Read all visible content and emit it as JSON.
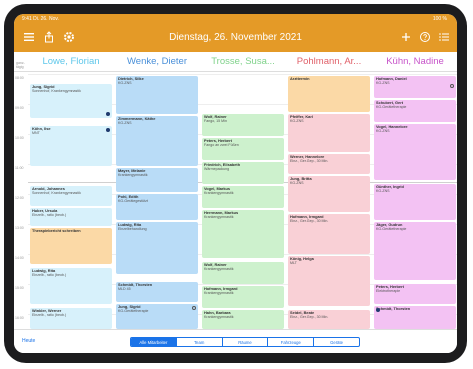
{
  "status": {
    "time": "9:41 Di. 26. Nov.",
    "right": "100 %"
  },
  "toolbar": {
    "title": "Dienstag, 26. November 2021"
  },
  "allday_label": "ganz-tägig",
  "columns": [
    {
      "name": "Lowe, Florian",
      "color": "#5ec7ea"
    },
    {
      "name": "Wenke, Dieter",
      "color": "#4a90d9"
    },
    {
      "name": "Trosse, Susa...",
      "color": "#7fd28a"
    },
    {
      "name": "Pohlmann, Ar...",
      "color": "#e0616a"
    },
    {
      "name": "Kühn, Nadine",
      "color": "#c653c9"
    }
  ],
  "hours": [
    "08:00",
    "09:00",
    "10:00",
    "11:00",
    "12:00",
    "13:00",
    "14:00",
    "15:00",
    "16:00"
  ],
  "appointments": [
    {
      "col": 0,
      "title": "Jung, Sigrid",
      "sub": "Sonnenhof, Krankengymnastik",
      "color": "#d7f1fb",
      "marker": "none"
    },
    {
      "col": 0,
      "title": "Köhn, Ilse",
      "sub": "MNT",
      "color": "#d7f1fb",
      "marker": "dot"
    },
    {
      "col": 0,
      "title": "Arnold, Johannes",
      "sub": "Sonnenhof, Krankengymnastik",
      "color": "#d7f1fb",
      "marker": "none"
    },
    {
      "col": 0,
      "title": "Huber, Ursula",
      "sub": "Einzelb., ratio (beob.)",
      "color": "#d7f1fb",
      "marker": "none"
    },
    {
      "col": 0,
      "title": "Therapiebericht schreiben",
      "sub": "",
      "color": "#fbd9a6",
      "marker": "none"
    },
    {
      "col": 0,
      "title": "Ludwig, Rita",
      "sub": "Einzelb., ratio (beob.)",
      "color": "#d7f1fb",
      "marker": "none"
    },
    {
      "col": 0,
      "title": "Winkler, Werner",
      "sub": "Einzelb., ratio (beob.)",
      "color": "#d7f1fb",
      "marker": "none"
    },
    {
      "col": 1,
      "title": "Dietrich, Silke",
      "sub": "KG-ZNS",
      "color": "#b9dcf7",
      "marker": "none"
    },
    {
      "col": 1,
      "title": "Zimmermann, Käthe",
      "sub": "KG-ZNS",
      "color": "#b9dcf7",
      "marker": "none"
    },
    {
      "col": 1,
      "title": "Mayer, Melanie",
      "sub": "Krankengymnastik",
      "color": "#b9dcf7",
      "marker": "none"
    },
    {
      "col": 1,
      "title": "Pohl, Edith",
      "sub": "KG-Gerätegestützt",
      "color": "#b9dcf7",
      "marker": "none"
    },
    {
      "col": 1,
      "title": "Ludwig, Rita",
      "sub": "Einzelbehandlung",
      "color": "#b9dcf7",
      "marker": "none"
    },
    {
      "col": 1,
      "title": "Schmidt, Thorsten",
      "sub": "MLD 45",
      "color": "#b9dcf7",
      "marker": "none"
    },
    {
      "col": 1,
      "title": "Jung, Sigrid",
      "sub": "KG-Gerätetherapie",
      "color": "#b9dcf7",
      "marker": "ring"
    },
    {
      "col": 2,
      "title": "Wolf, Rainer",
      "sub": "Fango, 15 Min",
      "color": "#cdf1cd",
      "marker": "none"
    },
    {
      "col": 2,
      "title": "Peters, Herbert",
      "sub": "Fango an zwei Füßen",
      "color": "#cdf1cd",
      "marker": "none"
    },
    {
      "col": 2,
      "title": "Friedrich, Elisabeth",
      "sub": "Wärmepackung",
      "color": "#cdf1cd",
      "marker": "none"
    },
    {
      "col": 2,
      "title": "Vogel, Markus",
      "sub": "Krankengymnastik",
      "color": "#cdf1cd",
      "marker": "none"
    },
    {
      "col": 2,
      "title": "Herrmann, Markus",
      "sub": "Krankengymnastik",
      "color": "#cdf1cd",
      "marker": "none"
    },
    {
      "col": 2,
      "title": "Wolf, Rainer",
      "sub": "Krankengymnastik",
      "color": "#cdf1cd",
      "marker": "none"
    },
    {
      "col": 2,
      "title": "Hofmann, Irmgard",
      "sub": "Krankengymnastik",
      "color": "#cdf1cd",
      "marker": "none"
    },
    {
      "col": 2,
      "title": "Hahn, Barbara",
      "sub": "Krankengymnastik",
      "color": "#cdf1cd",
      "marker": "none"
    },
    {
      "col": 3,
      "title": "Arzttermin",
      "sub": "",
      "color": "#fbd9a6",
      "marker": "none"
    },
    {
      "col": 3,
      "title": "Pfeiffer, Karl",
      "sub": "KG-ZNS",
      "color": "#f9d0d6",
      "marker": "none"
    },
    {
      "col": 3,
      "title": "Werner, Hannelore",
      "sub": "Einz., Ger.Gep., 30 Min.",
      "color": "#f9d0d6",
      "marker": "none"
    },
    {
      "col": 3,
      "title": "Jung, Britta",
      "sub": "KG-ZNS",
      "color": "#f9d0d6",
      "marker": "none"
    },
    {
      "col": 3,
      "title": "Hofmann, Irmgard",
      "sub": "Einz., Ger.Gep., 30 Min.",
      "color": "#f9d0d6",
      "marker": "none"
    },
    {
      "col": 3,
      "title": "König, Helga",
      "sub": "MLT",
      "color": "#f9d0d6",
      "marker": "none"
    },
    {
      "col": 3,
      "title": "Seidel, Beate",
      "sub": "Einz., Ger.Gep., 30 Min.",
      "color": "#f9d0d6",
      "marker": "none"
    },
    {
      "col": 4,
      "title": "Hofmann, Daniel",
      "sub": "KG-ZNS",
      "color": "#f3c2f3",
      "marker": "ring"
    },
    {
      "col": 4,
      "title": "Schubert, Gert",
      "sub": "KG-Gerätetherapie",
      "color": "#f3c2f3",
      "marker": "none"
    },
    {
      "col": 4,
      "title": "Vogel, Hannelore",
      "sub": "KG-ZNS",
      "color": "#f3c2f3",
      "marker": "none"
    },
    {
      "col": 4,
      "title": "Günther, Ingrid",
      "sub": "KG-ZNS",
      "color": "#f3c2f3",
      "marker": "none"
    },
    {
      "col": 4,
      "title": "Jäger, Gudrun",
      "sub": "KG-Gerätetherapie",
      "color": "#f3c2f3",
      "marker": "none"
    },
    {
      "col": 4,
      "title": "Peters, Herbert",
      "sub": "Elektrotherapie",
      "color": "#f3c2f3",
      "marker": "none"
    },
    {
      "col": 4,
      "title": "Schmidt, Thorsten",
      "sub": "",
      "color": "#f3c2f3",
      "marker": "dot"
    }
  ],
  "bottom": {
    "today": "Heute",
    "segments": [
      "Alle Mitarbeiter",
      "Team",
      "Räume",
      "Fahrzeuge",
      "Geräte"
    ],
    "active_segment": "Alle Mitarbeiter"
  },
  "icons": [
    "menu-icon",
    "share-icon",
    "settings-icon",
    "add-icon",
    "help-icon",
    "list-icon"
  ]
}
